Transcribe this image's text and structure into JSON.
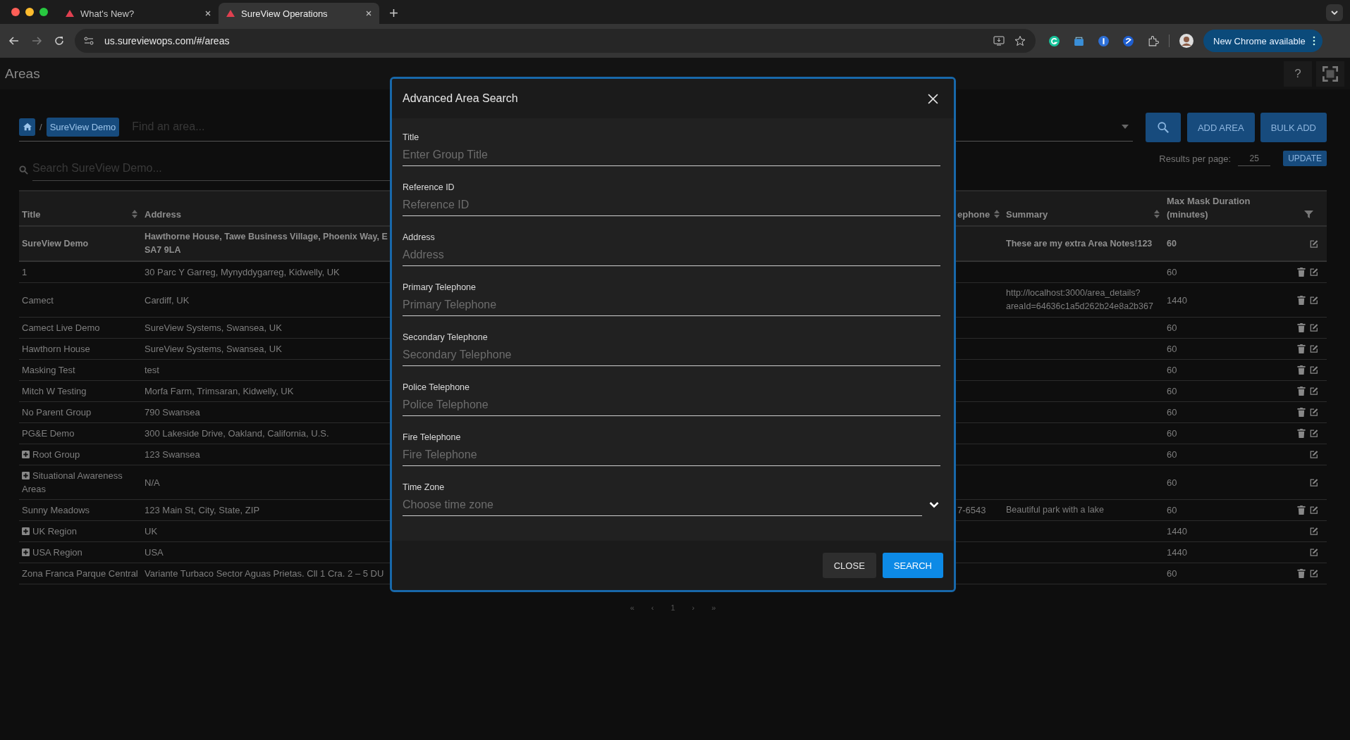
{
  "browser": {
    "tabs": [
      {
        "title": "What's New?",
        "selected": false
      },
      {
        "title": "SureView Operations",
        "selected": true
      }
    ],
    "url": "us.sureviewops.com/#/areas",
    "update_button": "New Chrome available"
  },
  "page": {
    "title": "Areas",
    "help_button": "?"
  },
  "toolbar": {
    "separator": "/",
    "breadcrumb": [
      "SureView Demo"
    ],
    "find_placeholder": "Find an area...",
    "buttons": [
      "ADD AREA",
      "BULK ADD"
    ]
  },
  "search": {
    "placeholder": "Search SureView Demo..."
  },
  "results_per_page": {
    "label": "Results per page:",
    "value": "25",
    "button": "UPDATE"
  },
  "table": {
    "columns": [
      {
        "label": "Title",
        "sortable": true
      },
      {
        "label": "Address",
        "sortable": false
      },
      {
        "label": "ephone",
        "sortable": true
      },
      {
        "label": "Summary",
        "sortable": true
      },
      {
        "label": "Max Mask Duration (minutes)",
        "sortable": false
      }
    ],
    "rows": [
      {
        "title": "SureView Demo",
        "address": "Hawthorne House, Tawe Business Village, Phoenix Way, E\nSA7 9LA",
        "summary": "These are my extra Area Notes!123",
        "max_mask": "60",
        "selected": true,
        "expandable": false,
        "deletable": false
      },
      {
        "title": "1",
        "address": "30 Parc Y Garreg, Mynyddygarreg, Kidwelly, UK",
        "max_mask": "60",
        "selected": false,
        "expandable": false,
        "deletable": true
      },
      {
        "title": "Camect",
        "address": "Cardiff, UK",
        "summary": "http://localhost:3000/area_details?areaId=64636c1a5d262b24e8a2b367",
        "max_mask": "1440",
        "selected": false,
        "expandable": false,
        "deletable": true
      },
      {
        "title": "Camect Live Demo",
        "address": "SureView Systems, Swansea, UK",
        "max_mask": "60",
        "selected": false,
        "expandable": false,
        "deletable": true
      },
      {
        "title": "Hawthorn House",
        "address": "SureView Systems, Swansea, UK",
        "max_mask": "60",
        "selected": false,
        "expandable": false,
        "deletable": true
      },
      {
        "title": "Masking Test",
        "address": "test",
        "max_mask": "60",
        "selected": false,
        "expandable": false,
        "deletable": true
      },
      {
        "title": "Mitch W Testing",
        "address": "Morfa Farm, Trimsaran, Kidwelly, UK",
        "max_mask": "60",
        "selected": false,
        "expandable": false,
        "deletable": true
      },
      {
        "title": "No Parent Group",
        "address": "790 Swansea",
        "max_mask": "60",
        "selected": false,
        "expandable": false,
        "deletable": true
      },
      {
        "title": "PG&E Demo",
        "address": "300 Lakeside Drive, Oakland, California, U.S.",
        "max_mask": "60",
        "selected": false,
        "expandable": false,
        "deletable": true
      },
      {
        "title": "Root Group",
        "address": "123 Swansea",
        "max_mask": "60",
        "selected": false,
        "expandable": true,
        "deletable": false
      },
      {
        "title": "Situational Awareness Areas",
        "address": "N/A",
        "max_mask": "60",
        "selected": false,
        "expandable": true,
        "deletable": false
      },
      {
        "title": "Sunny Meadows",
        "address": "123 Main St, City, State, ZIP",
        "column_3": "7-6543",
        "summary": "Beautiful park with a lake",
        "max_mask": "60",
        "selected": false,
        "expandable": false,
        "deletable": true
      },
      {
        "title": "UK Region",
        "address": "UK",
        "max_mask": "1440",
        "selected": false,
        "expandable": true,
        "deletable": false
      },
      {
        "title": "USA Region",
        "address": "USA",
        "max_mask": "1440",
        "selected": false,
        "expandable": true,
        "deletable": false
      },
      {
        "title": "Zona Franca Parque Central",
        "address": "Variante Turbaco Sector Aguas Prietas. Cll 1 Cra. 2 – 5 DU",
        "max_mask": "60",
        "selected": false,
        "expandable": false,
        "deletable": true
      }
    ]
  },
  "pagination": [
    "«",
    "‹",
    "1",
    "›",
    "»"
  ],
  "dialog": {
    "title": "Advanced Area Search",
    "fields": [
      {
        "label": "Title",
        "placeholder": "Enter Group Title",
        "kind": "text"
      },
      {
        "label": "Reference ID",
        "placeholder": "Reference ID",
        "kind": "text"
      },
      {
        "label": "Address",
        "placeholder": "Address",
        "kind": "text"
      },
      {
        "label": "Primary Telephone",
        "placeholder": "Primary Telephone",
        "kind": "text"
      },
      {
        "label": "Secondary Telephone",
        "placeholder": "Secondary Telephone",
        "kind": "text"
      },
      {
        "label": "Police Telephone",
        "placeholder": "Police Telephone",
        "kind": "text"
      },
      {
        "label": "Fire Telephone",
        "placeholder": "Fire Telephone",
        "kind": "text"
      },
      {
        "label": "Time Zone",
        "placeholder": "Choose time zone",
        "kind": "select"
      }
    ],
    "buttons": [
      {
        "label": "CLOSE",
        "kind": "secondary"
      },
      {
        "label": "SEARCH",
        "kind": "primary"
      }
    ]
  }
}
